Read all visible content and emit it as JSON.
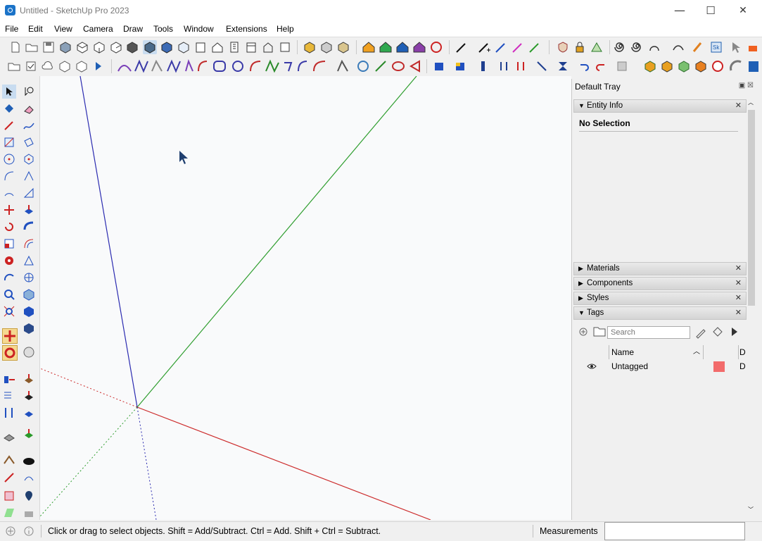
{
  "window": {
    "title": "Untitled - SketchUp Pro 2023",
    "minimize": "—",
    "maximize": "☐",
    "close": "✕"
  },
  "menu": [
    "File",
    "Edit",
    "View",
    "Camera",
    "Draw",
    "Tools",
    "Window",
    "Extensions",
    "Help"
  ],
  "tray": {
    "title": "Default Tray",
    "panels": {
      "entity_info": "Entity Info",
      "materials": "Materials",
      "components": "Components",
      "styles": "Styles",
      "tags": "Tags"
    },
    "entity_info_text": "No Selection",
    "tags_search_placeholder": "Search",
    "tags_columns": {
      "name": "Name",
      "d": "D"
    },
    "tag_rows": [
      {
        "name": "Untagged",
        "color": "#f26b6b",
        "visible": true
      }
    ]
  },
  "status": {
    "hint": "Click or drag to select objects. Shift = Add/Subtract. Ctrl = Add. Shift + Ctrl = Subtract.",
    "measurements_label": "Measurements",
    "measurements_value": ""
  },
  "colors": {
    "axis_red": "#cc2a2a",
    "axis_green": "#2f9e2f",
    "axis_blue": "#2b2bb0",
    "selection_highlight": "#7fb3e6"
  }
}
